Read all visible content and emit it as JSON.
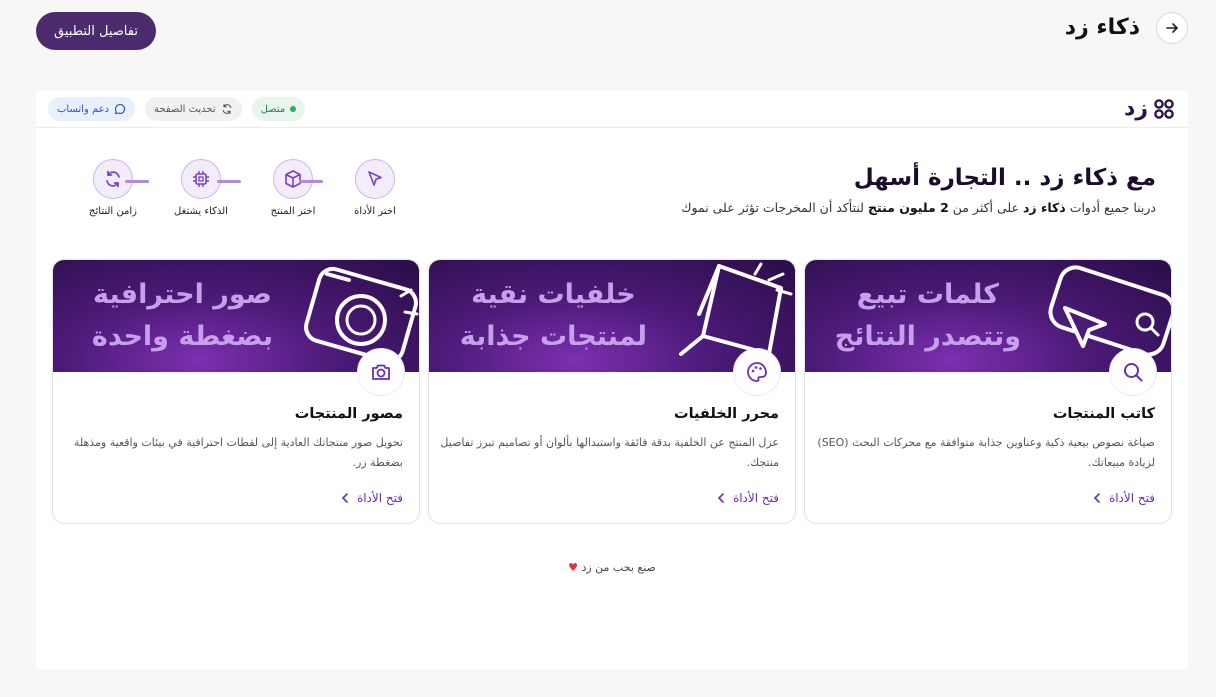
{
  "header": {
    "title": "ذكاء زد",
    "app_details_label": "تفاصيل التطبيق"
  },
  "frame_header": {
    "logo_text": "زد",
    "online_label": "متصل",
    "refresh_label": "تحديث الصفحة",
    "whatsapp_label": "دعم واتساب"
  },
  "hero": {
    "title": "مع ذكاء زد .. التجارة أسهل",
    "subtitle_parts": [
      "دربنا جميع أدوات ",
      "ذكاء زد",
      " على أكثر من ",
      "2 مليون منتج",
      " لنتأكد أن المخرجات تؤثر على نموك"
    ]
  },
  "steps": [
    {
      "label": "اختر الأداة",
      "icon": "cursor-icon"
    },
    {
      "label": "اختر المنتج",
      "icon": "box-icon"
    },
    {
      "label": "الذكاء يشتغل",
      "icon": "chip-icon"
    },
    {
      "label": "زامن النتائج",
      "icon": "sync-icon"
    }
  ],
  "cards": [
    {
      "banner_line1": "كلمات تبيع",
      "banner_line2": "وتتصدر النتائج",
      "title": "كاتب المنتجات",
      "desc": "صياغة نصوص بيعية ذكية وعناوين جذابة متوافقة مع محركات البحث (SEO) لزيادة مبيعاتك.",
      "open_label": "فتح الأداة",
      "icon": "search-icon"
    },
    {
      "banner_line1": "خلفيات نقية",
      "banner_line2": "لمنتجات جذابة",
      "title": "محرر الخلفيات",
      "desc": "عزل المنتج عن الخلفية بدقة فائقة واستبدالها بألوان أو تصاميم تبرز تفاصيل منتجك.",
      "open_label": "فتح الأداة",
      "icon": "palette-icon"
    },
    {
      "banner_line1": "صور احترافية",
      "banner_line2": "بضغطة واحدة",
      "title": "مصور المنتجات",
      "desc": "تحويل صور منتجاتك العادية إلى لقطات احترافية في بيئات واقعية ومذهلة بضغطة زر.",
      "open_label": "فتح الأداة",
      "icon": "camera-icon"
    }
  ],
  "footer": {
    "text": "صنع بحب من زد",
    "heart": "♥"
  },
  "colors": {
    "primary": "#4b2a6e",
    "accent": "#6b2fb3",
    "online": "#22b35e"
  }
}
